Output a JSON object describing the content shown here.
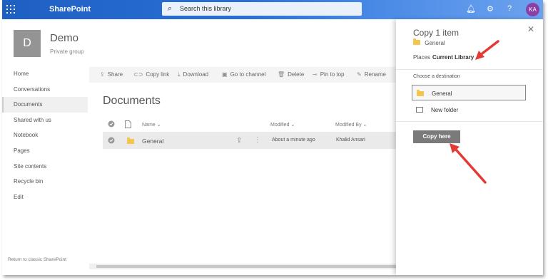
{
  "header": {
    "app_name": "SharePoint",
    "search_placeholder": "Search this library",
    "user_initials": "KA"
  },
  "site": {
    "logo_letter": "D",
    "title": "Demo",
    "subtitle": "Private group"
  },
  "leftnav": {
    "items": [
      {
        "label": "Home"
      },
      {
        "label": "Conversations"
      },
      {
        "label": "Documents"
      },
      {
        "label": "Shared with us"
      },
      {
        "label": "Notebook"
      },
      {
        "label": "Pages"
      },
      {
        "label": "Site contents"
      },
      {
        "label": "Recycle bin"
      },
      {
        "label": "Edit"
      }
    ],
    "classic_link": "Return to classic SharePoint"
  },
  "commands": {
    "share": "Share",
    "copy_link": "Copy link",
    "download": "Download",
    "go_to_channel": "Go to channel",
    "delete": "Delete",
    "pin_to_top": "Pin to top",
    "rename": "Rename"
  },
  "library": {
    "title": "Documents",
    "columns": {
      "name": "Name",
      "modified": "Modified",
      "modified_by": "Modified By"
    },
    "rows": [
      {
        "name": "General",
        "modified": "About a minute ago",
        "modified_by": "Khalid Ansari"
      }
    ]
  },
  "panel": {
    "title": "Copy 1 item",
    "item_name": "General",
    "places_label": "Places",
    "places_value": "Current Library",
    "choose_label": "Choose a destination",
    "destinations": [
      {
        "label": "General"
      },
      {
        "label": "New folder"
      }
    ],
    "copy_button": "Copy here"
  },
  "colors": {
    "topbar": "#2b6fd6",
    "avatar": "#8a3fa6",
    "arrow": "#e53935",
    "folder": "#f3c44e"
  }
}
